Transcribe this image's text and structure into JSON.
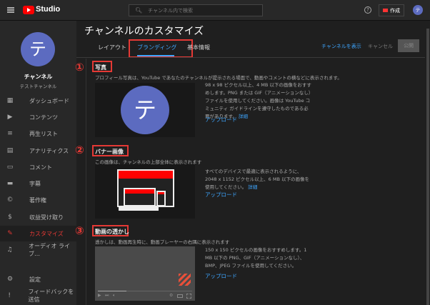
{
  "header": {
    "logo_text": "Studio",
    "search_placeholder": "チャンネル内で検索",
    "create_label": "作成",
    "avatar_letter": "テ"
  },
  "sidebar": {
    "avatar_letter": "テ",
    "channel_title": "チャンネル",
    "channel_name": "テストチャンネル",
    "items": [
      {
        "label": "ダッシュボード",
        "icon": "dashboard-icon"
      },
      {
        "label": "コンテンツ",
        "icon": "content-icon"
      },
      {
        "label": "再生リスト",
        "icon": "playlist-icon"
      },
      {
        "label": "アナリティクス",
        "icon": "analytics-icon"
      },
      {
        "label": "コメント",
        "icon": "comment-icon"
      },
      {
        "label": "字幕",
        "icon": "subtitles-icon"
      },
      {
        "label": "著作権",
        "icon": "copyright-icon"
      },
      {
        "label": "収益受け取り",
        "icon": "dollar-icon"
      },
      {
        "label": "カスタマイズ",
        "icon": "magic-wand-icon",
        "active": true
      },
      {
        "label": "オーディオ ライブ…",
        "icon": "audio-library-icon"
      }
    ],
    "bottom": [
      {
        "label": "設定",
        "icon": "gear-icon"
      },
      {
        "label": "フィードバックを送信",
        "icon": "feedback-icon"
      }
    ]
  },
  "main": {
    "title": "チャンネルのカスタマイズ",
    "tabs": [
      {
        "label": "レイアウト"
      },
      {
        "label": "ブランディング",
        "active": true
      },
      {
        "label": "基本情報"
      }
    ],
    "view_channel": "チャンネルを表示",
    "cancel": "キャンセル",
    "publish": "公開",
    "sections": [
      {
        "num": "①",
        "title": "写真",
        "desc": "プロフィール写真は、YouTube であなたのチャンネルが提示される場面で、動画やコメントの横などに表示されます。",
        "info": "98 x 98 ピクセル以上、4 MB 以下の画像をおすすめします。PNG または GIF（アニメーションなし）ファイルを使用してください。画像は YouTube コミュニティ ガイドラインを遵守したものである必要があります。",
        "more": "詳細",
        "upload": "アップロード",
        "avatar_letter": "テ"
      },
      {
        "num": "②",
        "title": "バナー画像",
        "desc": "この画像は、チャンネルの上部全体に表示されます",
        "info": "すべてのデバイスで最適に表示されるように、2048 x 1152 ピクセル以上、6 MB 以下の画像を使用してください。",
        "more": "詳細",
        "upload": "アップロード"
      },
      {
        "num": "③",
        "title": "動画の透かし",
        "desc": "透かしは、動画再生時に、動画プレーヤーの右隅に表示されます",
        "info": "150 x 150 ピクセルの画像をおすすめします。1 MB 以下の PNG、GIF（アニメーションなし）、BMP、JPEG ファイルを使用してください。",
        "upload": "アップロード"
      }
    ]
  },
  "colors": {
    "accent": "#3ea6ff",
    "red": "#e53935",
    "avatar": "#5c6bc0"
  }
}
